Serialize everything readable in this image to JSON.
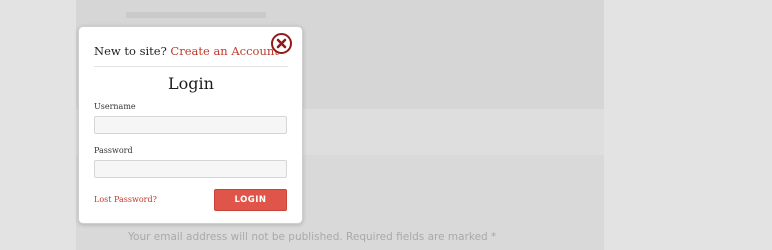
{
  "modal": {
    "signup_prompt": "New to site?",
    "signup_link": "Create an Account",
    "title": "Login",
    "username_label": "Username",
    "password_label": "Password",
    "username_value": "",
    "password_value": "",
    "lost_password": "Lost Password?",
    "login_button": "LOGIN",
    "close_icon": "close-circle-icon"
  },
  "background": {
    "notice": "Your email address will not be published. Required fields are marked *"
  },
  "colors": {
    "accent": "#c0392b",
    "button": "#e0554a",
    "close_ring": "#8e1a1a"
  }
}
